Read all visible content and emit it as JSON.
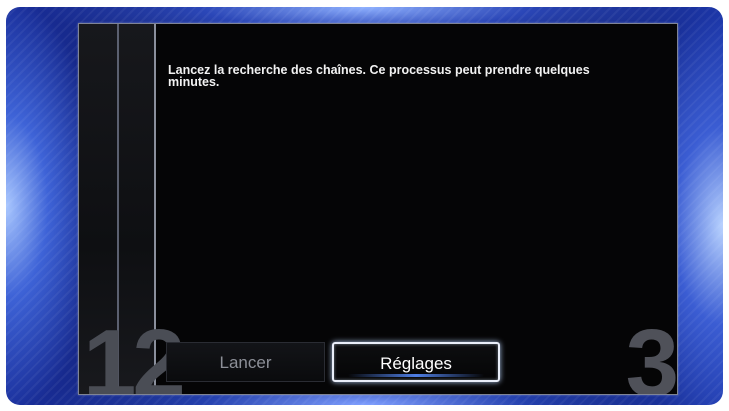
{
  "wizard": {
    "message": "Lancez la recherche des chaînes. Ce processus peut prendre quelques minutes.",
    "completed_steps": "12",
    "next_step": "3",
    "buttons": {
      "launch": "Lancer",
      "settings": "Réglages"
    }
  }
}
